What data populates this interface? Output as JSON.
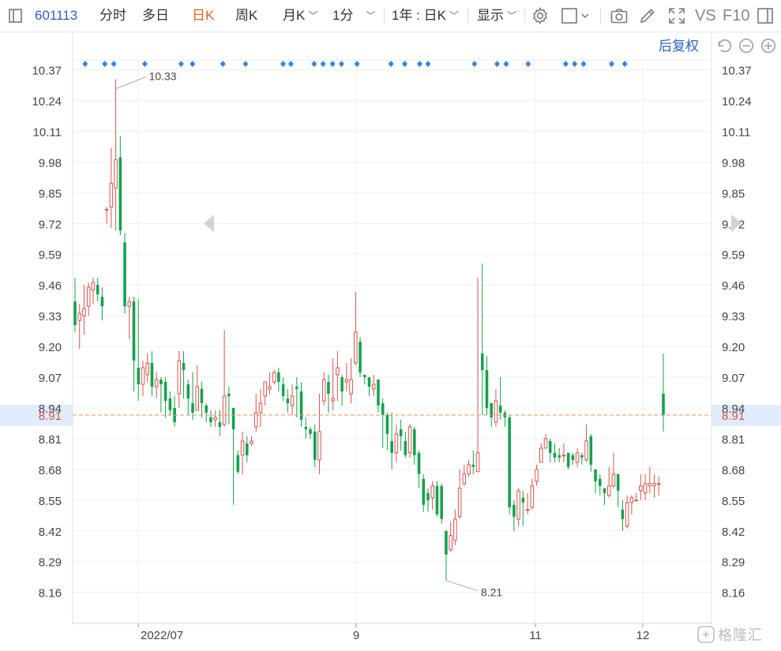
{
  "toolbar": {
    "stock_code": "601113",
    "tabs": [
      "分时",
      "多日",
      "日K",
      "周K",
      "月K",
      "1分"
    ],
    "active_tab": "日K",
    "range_label": "1年 : 日K",
    "display_label": "显示",
    "vs_label": "VS",
    "f10_label": "F10"
  },
  "adjust_label": "后复权",
  "highlight_color": "#e0ecfb",
  "up_color": "#d9534f",
  "down_color": "#12a24b",
  "marker_color": "#2f86ea",
  "chart_data": {
    "type": "candlestick",
    "y_ticks": [
      10.37,
      10.24,
      10.11,
      9.98,
      9.85,
      9.72,
      9.59,
      9.46,
      9.33,
      9.2,
      9.07,
      8.94,
      8.81,
      8.68,
      8.55,
      8.42,
      8.29,
      8.16
    ],
    "ylim": [
      8.06,
      10.4
    ],
    "x_labels": [
      "2022/07",
      "9",
      "11",
      "12"
    ],
    "current_price": "8.91",
    "max_annotation": "10.33",
    "min_annotation": "8.21",
    "grid": true,
    "candles": [
      [
        9.39,
        9.29,
        9.49,
        9.26
      ],
      [
        9.31,
        9.34,
        9.38,
        9.19
      ],
      [
        9.33,
        9.36,
        9.46,
        9.25
      ],
      [
        9.37,
        9.45,
        9.47,
        9.33
      ],
      [
        9.44,
        9.47,
        9.49,
        9.38
      ],
      [
        9.46,
        9.42,
        9.49,
        9.39
      ],
      [
        9.41,
        9.37,
        9.45,
        9.31
      ],
      [
        9.78,
        9.78,
        9.79,
        9.72
      ],
      [
        9.79,
        9.89,
        10.04,
        9.7
      ],
      [
        9.87,
        9.99,
        10.33,
        9.69
      ],
      [
        10.0,
        9.69,
        10.09,
        9.67
      ],
      [
        9.64,
        9.37,
        9.68,
        9.34
      ],
      [
        9.37,
        9.39,
        9.41,
        9.23
      ],
      [
        9.39,
        9.14,
        9.41,
        9.01
      ],
      [
        9.11,
        9.04,
        9.4,
        8.97
      ],
      [
        9.04,
        9.11,
        9.14,
        8.99
      ],
      [
        9.08,
        9.13,
        9.17,
        9.05
      ],
      [
        9.13,
        9.03,
        9.18,
        8.99
      ],
      [
        9.03,
        9.06,
        9.09,
        8.98
      ],
      [
        9.06,
        9.04,
        9.07,
        8.92
      ],
      [
        9.05,
        8.97,
        9.07,
        8.9
      ],
      [
        8.98,
        8.93,
        9.01,
        8.91
      ],
      [
        8.94,
        8.88,
        8.99,
        8.86
      ],
      [
        9.0,
        9.14,
        9.18,
        8.94
      ],
      [
        9.13,
        9.1,
        9.18,
        8.98
      ],
      [
        9.04,
        8.98,
        9.06,
        8.91
      ],
      [
        8.96,
        8.92,
        9.09,
        8.89
      ],
      [
        8.93,
        9.03,
        9.12,
        8.93
      ],
      [
        9.02,
        8.96,
        9.05,
        8.9
      ],
      [
        8.95,
        8.92,
        8.96,
        8.88
      ],
      [
        8.9,
        8.88,
        8.93,
        8.86
      ],
      [
        8.89,
        8.9,
        8.93,
        8.86
      ],
      [
        8.88,
        8.86,
        8.93,
        8.82
      ],
      [
        8.87,
        8.99,
        9.27,
        8.86
      ],
      [
        9.0,
        8.99,
        9.03,
        8.87
      ],
      [
        8.94,
        8.85,
        8.94,
        8.53
      ],
      [
        8.74,
        8.67,
        8.76,
        8.66
      ],
      [
        8.74,
        8.8,
        8.84,
        8.66
      ],
      [
        8.79,
        8.74,
        8.82,
        8.71
      ],
      [
        8.79,
        8.8,
        8.82,
        8.78
      ],
      [
        8.86,
        8.92,
        9.0,
        8.84
      ],
      [
        8.92,
        8.96,
        9.02,
        8.86
      ],
      [
        8.99,
        9.05,
        9.05,
        8.95
      ],
      [
        9.02,
        9.03,
        9.09,
        9.0
      ],
      [
        9.05,
        9.09,
        9.1,
        9.04
      ],
      [
        9.09,
        9.05,
        9.11,
        9.01
      ],
      [
        9.04,
        8.99,
        9.07,
        8.97
      ],
      [
        8.98,
        8.96,
        9.02,
        8.92
      ],
      [
        8.95,
        8.99,
        9.04,
        8.91
      ],
      [
        9.03,
        9.02,
        9.07,
        8.9
      ],
      [
        9.01,
        8.89,
        9.05,
        8.86
      ],
      [
        8.86,
        8.85,
        8.9,
        8.81
      ],
      [
        8.85,
        8.83,
        8.86,
        8.81
      ],
      [
        8.84,
        8.72,
        8.87,
        8.69
      ],
      [
        8.72,
        8.84,
        9.0,
        8.66
      ],
      [
        8.97,
        9.06,
        9.09,
        8.95
      ],
      [
        9.05,
        9.0,
        9.08,
        8.92
      ],
      [
        8.97,
        8.98,
        9.15,
        8.93
      ],
      [
        9.08,
        9.11,
        9.18,
        8.97
      ],
      [
        9.07,
        9.01,
        9.08,
        8.95
      ],
      [
        9.05,
        9.06,
        9.13,
        9.01
      ],
      [
        9.0,
        9.06,
        9.15,
        8.96
      ],
      [
        9.13,
        9.26,
        9.43,
        9.12
      ],
      [
        9.22,
        9.09,
        9.24,
        9.07
      ],
      [
        9.08,
        9.07,
        9.08,
        9.04
      ],
      [
        9.07,
        9.03,
        9.07,
        8.99
      ],
      [
        9.02,
        9.04,
        9.08,
        8.99
      ],
      [
        9.06,
        8.95,
        9.06,
        8.92
      ],
      [
        8.96,
        8.91,
        8.98,
        8.77
      ],
      [
        8.91,
        8.83,
        8.92,
        8.76
      ],
      [
        8.8,
        8.75,
        8.92,
        8.68
      ],
      [
        8.75,
        8.83,
        8.87,
        8.71
      ],
      [
        8.85,
        8.82,
        8.89,
        8.76
      ],
      [
        8.8,
        8.74,
        8.84,
        8.73
      ],
      [
        8.75,
        8.86,
        8.87,
        8.73
      ],
      [
        8.85,
        8.74,
        8.86,
        8.7
      ],
      [
        8.75,
        8.66,
        8.76,
        8.6
      ],
      [
        8.64,
        8.53,
        8.66,
        8.5
      ],
      [
        8.58,
        8.55,
        8.6,
        8.5
      ],
      [
        8.56,
        8.61,
        8.63,
        8.51
      ],
      [
        8.61,
        8.49,
        8.63,
        8.48
      ],
      [
        8.61,
        8.47,
        8.62,
        8.45
      ],
      [
        8.42,
        8.32,
        8.42,
        8.21
      ],
      [
        8.34,
        8.4,
        8.46,
        8.33
      ],
      [
        8.38,
        8.47,
        8.51,
        8.36
      ],
      [
        8.48,
        8.6,
        8.68,
        8.47
      ],
      [
        8.62,
        8.66,
        8.7,
        8.61
      ],
      [
        8.66,
        8.7,
        8.72,
        8.65
      ],
      [
        8.7,
        8.69,
        8.76,
        8.66
      ],
      [
        8.67,
        8.75,
        9.49,
        8.67
      ],
      [
        9.17,
        9.1,
        9.55,
        8.91
      ],
      [
        9.1,
        8.94,
        9.16,
        8.91
      ],
      [
        8.96,
        8.9,
        8.96,
        8.86
      ],
      [
        8.88,
        8.97,
        9.02,
        8.86
      ],
      [
        8.95,
        8.92,
        9.07,
        8.89
      ],
      [
        8.92,
        8.9,
        8.93,
        8.86
      ],
      [
        8.9,
        8.52,
        8.91,
        8.49
      ],
      [
        8.53,
        8.48,
        8.55,
        8.42
      ],
      [
        8.47,
        8.59,
        8.6,
        8.44
      ],
      [
        8.56,
        8.54,
        8.59,
        8.44
      ],
      [
        8.51,
        8.51,
        8.58,
        8.49
      ],
      [
        8.52,
        8.61,
        8.64,
        8.51
      ],
      [
        8.63,
        8.68,
        8.7,
        8.61
      ],
      [
        8.71,
        8.77,
        8.79,
        8.71
      ],
      [
        8.77,
        8.81,
        8.83,
        8.77
      ],
      [
        8.8,
        8.75,
        8.81,
        8.71
      ],
      [
        8.75,
        8.73,
        8.79,
        8.71
      ],
      [
        8.74,
        8.73,
        8.77,
        8.71
      ],
      [
        8.74,
        8.74,
        8.79,
        8.71
      ],
      [
        8.75,
        8.69,
        8.75,
        8.68
      ],
      [
        8.74,
        8.72,
        8.75,
        8.7
      ],
      [
        8.71,
        8.75,
        8.77,
        8.69
      ],
      [
        8.74,
        8.73,
        8.75,
        8.7
      ],
      [
        8.72,
        8.8,
        8.87,
        8.71
      ],
      [
        8.82,
        8.7,
        8.83,
        8.67
      ],
      [
        8.68,
        8.63,
        8.68,
        8.58
      ],
      [
        8.64,
        8.61,
        8.66,
        8.57
      ],
      [
        8.6,
        8.58,
        8.6,
        8.53
      ],
      [
        8.57,
        8.61,
        8.69,
        8.56
      ],
      [
        8.61,
        8.66,
        8.75,
        8.6
      ],
      [
        8.66,
        8.59,
        8.66,
        8.52
      ],
      [
        8.51,
        8.47,
        8.55,
        8.42
      ],
      [
        8.44,
        8.54,
        8.57,
        8.43
      ],
      [
        8.54,
        8.56,
        8.57,
        8.49
      ],
      [
        8.55,
        8.55,
        8.58,
        8.55
      ],
      [
        8.59,
        8.61,
        8.66,
        8.55
      ],
      [
        8.58,
        8.62,
        8.66,
        8.55
      ],
      [
        8.61,
        8.62,
        8.69,
        8.58
      ],
      [
        8.61,
        8.62,
        8.66,
        8.56
      ],
      [
        8.62,
        8.62,
        8.65,
        8.57
      ],
      [
        9.0,
        8.91,
        9.17,
        8.84
      ]
    ],
    "markers_at": [
      0.017,
      0.05,
      0.065,
      0.117,
      0.178,
      0.197,
      0.248,
      0.286,
      0.349,
      0.362,
      0.401,
      0.416,
      0.432,
      0.447,
      0.473,
      0.53,
      0.553,
      0.578,
      0.592,
      0.67,
      0.708,
      0.723,
      0.76,
      0.823,
      0.838,
      0.853,
      0.9,
      0.922
    ]
  }
}
